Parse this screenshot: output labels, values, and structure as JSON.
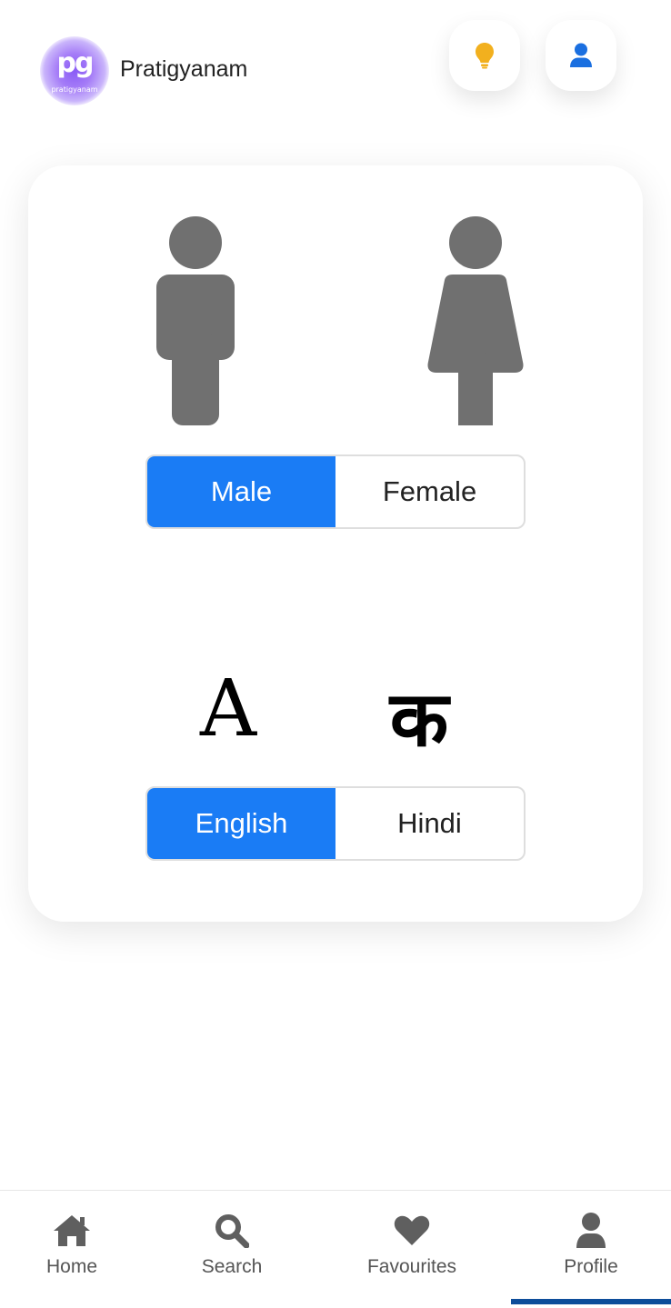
{
  "header": {
    "logo_text": "pg",
    "logo_subtext": "pratigyanam",
    "app_title": "Pratigyanam",
    "idea_icon": "lightbulb-icon",
    "user_icon": "user-icon",
    "idea_color": "#f2b01e",
    "user_color": "#1a6fe0"
  },
  "gender": {
    "male_icon": "male-figure-icon",
    "female_icon": "female-figure-icon",
    "options": [
      "Male",
      "Female"
    ],
    "selected": "Male"
  },
  "language": {
    "english_glyph": "A",
    "hindi_glyph": "क",
    "options": [
      "English",
      "Hindi"
    ],
    "selected": "English"
  },
  "colors": {
    "accent": "#1a7cf5",
    "figure_gray": "#707070",
    "nav_indicator": "#0d4d9a"
  },
  "bottom_nav": {
    "items": [
      {
        "label": "Home",
        "icon": "home-icon"
      },
      {
        "label": "Search",
        "icon": "search-icon"
      },
      {
        "label": "Favourites",
        "icon": "heart-icon"
      },
      {
        "label": "Profile",
        "icon": "profile-icon"
      }
    ],
    "active": "Profile"
  }
}
